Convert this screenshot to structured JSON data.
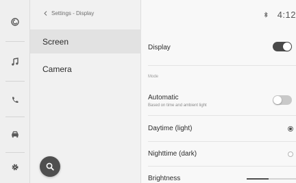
{
  "rail": {
    "items": [
      {
        "icon": "connected-services-icon"
      },
      {
        "icon": "music-note-icon"
      },
      {
        "icon": "phone-icon"
      },
      {
        "icon": "car-icon"
      },
      {
        "icon": "settings-gear-icon"
      }
    ]
  },
  "breadcrumb": "Settings - Display",
  "list": {
    "items": [
      {
        "label": "Screen",
        "selected": true
      },
      {
        "label": "Camera",
        "selected": false
      }
    ]
  },
  "status": {
    "time": "4:12",
    "icon": "bluetooth-icon"
  },
  "settings": {
    "display_label": "Display",
    "display_on": true,
    "mode_section": "Mode",
    "automatic_label": "Automatic",
    "automatic_sub": "Based on time and ambient light",
    "automatic_on": false,
    "daytime_label": "Daytime (light)",
    "daytime_selected": true,
    "nighttime_label": "Nighttime (dark)",
    "nighttime_selected": false,
    "brightness_label": "Brightness",
    "brightness_level": 0.45
  },
  "colors": {
    "toggle_on": "#4a4a4a",
    "toggle_off": "#c9c9c9",
    "fab": "#4f4f4f"
  }
}
